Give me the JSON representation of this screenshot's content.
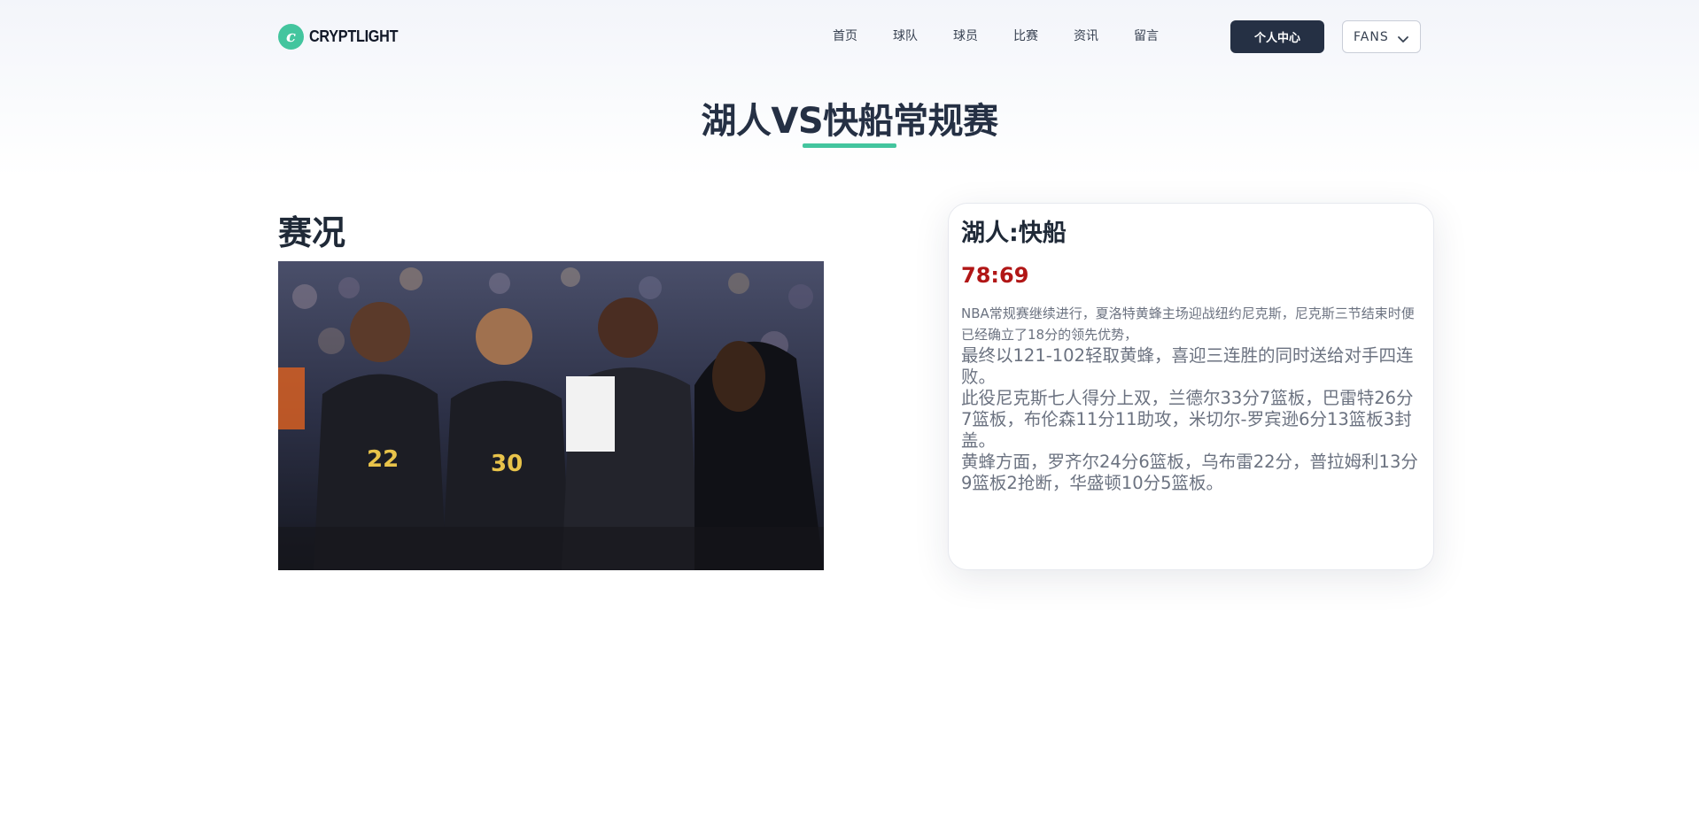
{
  "brand": {
    "name": "CRYPTLIGHT",
    "logo_glyph": "c",
    "accent": "#43c59e"
  },
  "nav": [
    {
      "label": "首页"
    },
    {
      "label": "球队"
    },
    {
      "label": "球员"
    },
    {
      "label": "比赛"
    },
    {
      "label": "资讯"
    },
    {
      "label": "留言"
    }
  ],
  "header": {
    "personal_center_label": "个人中心",
    "fans_select_value": "FANS"
  },
  "page": {
    "title": "湖人VS快船常规赛"
  },
  "left": {
    "heading": "赛况"
  },
  "card": {
    "title": "湖人:快船",
    "score": "78:69",
    "intro": "NBA常规赛继续进行，夏洛特黄蜂主场迎战纽约尼克斯，尼克斯三节结束时便已经确立了18分的领先优势，",
    "paragraphs": [
      "最终以121-102轻取黄蜂，喜迎三连胜的同时送给对手四连败。",
      "此役尼克斯七人得分上双，兰德尔33分7篮板，巴雷特26分7篮板，布伦森11分11助攻，米切尔-罗宾逊6分13篮板3封盖。",
      "黄蜂方面，罗齐尔24分6篮板，乌布雷22分，普拉姆利13分9篮板2抢断，华盛顿10分5篮板。"
    ]
  },
  "colors": {
    "dark": "#253044",
    "score": "#b11616",
    "text_muted": "#6b7280"
  }
}
